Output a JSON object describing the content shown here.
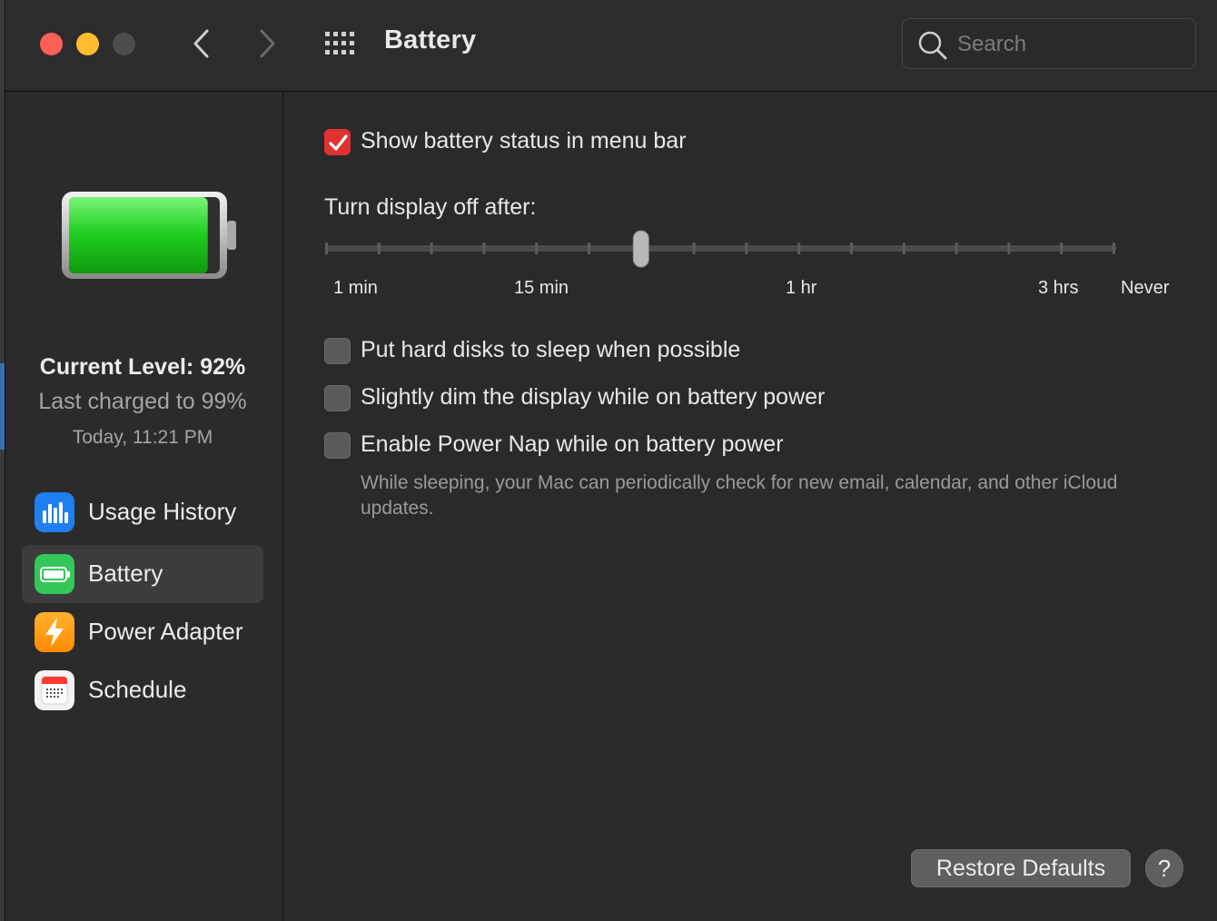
{
  "window": {
    "title": "Battery",
    "search_placeholder": "Search"
  },
  "sidebar": {
    "current_level": "Current Level: 92%",
    "level_value": 0.92,
    "last_charged": "Last charged to 99%",
    "charged_time": "Today, 11:21 PM",
    "items": [
      {
        "label": "Usage History",
        "icon": "bar-chart-icon",
        "selected": false
      },
      {
        "label": "Battery",
        "icon": "battery-icon",
        "selected": true
      },
      {
        "label": "Power Adapter",
        "icon": "lightning-icon",
        "selected": false
      },
      {
        "label": "Schedule",
        "icon": "calendar-icon",
        "selected": false
      }
    ]
  },
  "content": {
    "show_status": {
      "label": "Show battery status in menu bar",
      "checked": true
    },
    "display_off": {
      "label": "Turn display off after:",
      "tick_labels": [
        "1 min",
        "15 min",
        "1 hr",
        "3 hrs",
        "Never"
      ],
      "tick_count": 16,
      "selected_tick_index": 6
    },
    "options": [
      {
        "label": "Put hard disks to sleep when possible",
        "checked": false
      },
      {
        "label": "Slightly dim the display while on battery power",
        "checked": false
      },
      {
        "label": "Enable Power Nap while on battery power",
        "checked": false
      }
    ],
    "power_nap_note": "While sleeping, your Mac can periodically check for new email, calendar, and other iCloud updates.",
    "restore_defaults": "Restore Defaults",
    "help": "?"
  },
  "colors": {
    "accent_checkbox": "#e0322f",
    "battery_green": "#2fd12f",
    "close": "#ff5f57",
    "minimize": "#febc2e"
  }
}
